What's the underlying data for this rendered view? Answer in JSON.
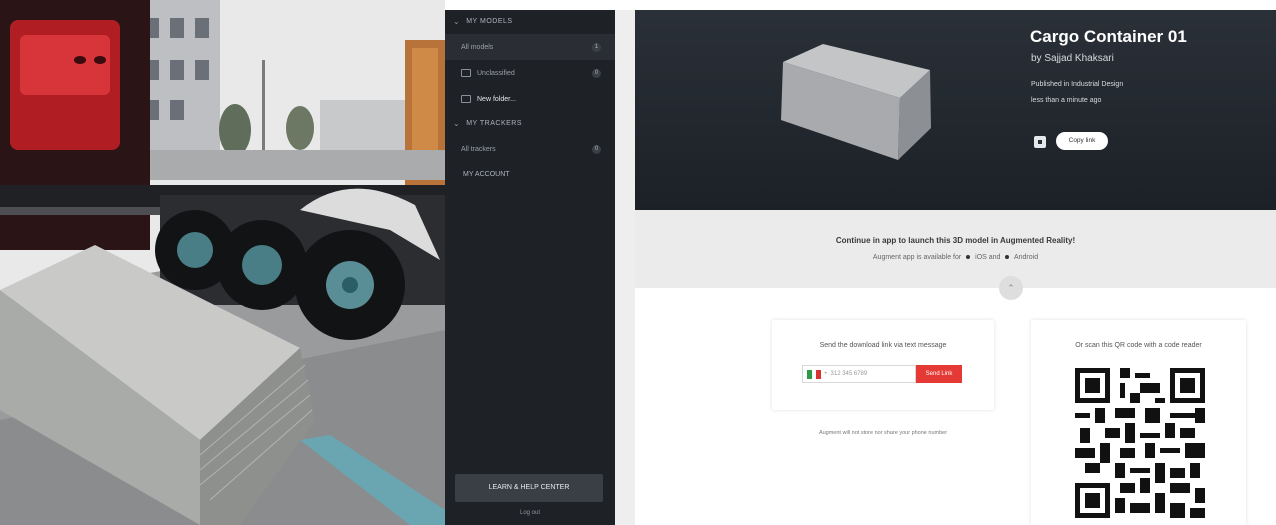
{
  "sidebar": {
    "my_models_header": "MY MODELS",
    "my_models_items": [
      {
        "label": "All models",
        "count": "1"
      },
      {
        "label": "Unclassified",
        "count": "0"
      },
      {
        "label": "New folder..."
      }
    ],
    "my_trackers_header": "MY TRACKERS",
    "my_trackers_items": [
      {
        "label": "All trackers",
        "count": "0"
      }
    ],
    "my_account": "MY ACCOUNT",
    "help_button": "LEARN & HELP CENTER",
    "logout": "Log out"
  },
  "model": {
    "title": "Cargo Container 01",
    "byline": "by Sajjad Khaksari",
    "published": "Published in Industrial Design",
    "time": "less than a minute ago",
    "copy_link": "Copy link"
  },
  "cta": {
    "headline": "Continue in app to launch this 3D model in Augmented Reality!",
    "available_text": "Augment app is available for",
    "platform_ios": "iOS and",
    "platform_android": "Android"
  },
  "sms": {
    "title": "Send the download link via text message",
    "phone_placeholder": "312 345 6789",
    "country_code": "+",
    "send_label": "Send Link",
    "note": "Augment will not store nor share your phone number"
  },
  "qr": {
    "title": "Or scan this QR code with a code reader"
  },
  "colors": {
    "sidebar_bg": "#1e2126",
    "banner_bg": "#232930",
    "send_button": "#e53935"
  },
  "icons": [
    "chevron-down-icon",
    "folder-icon",
    "new-folder-icon",
    "share-icon",
    "collapse-icon",
    "italy-flag-icon",
    "qr-code-icon"
  ]
}
